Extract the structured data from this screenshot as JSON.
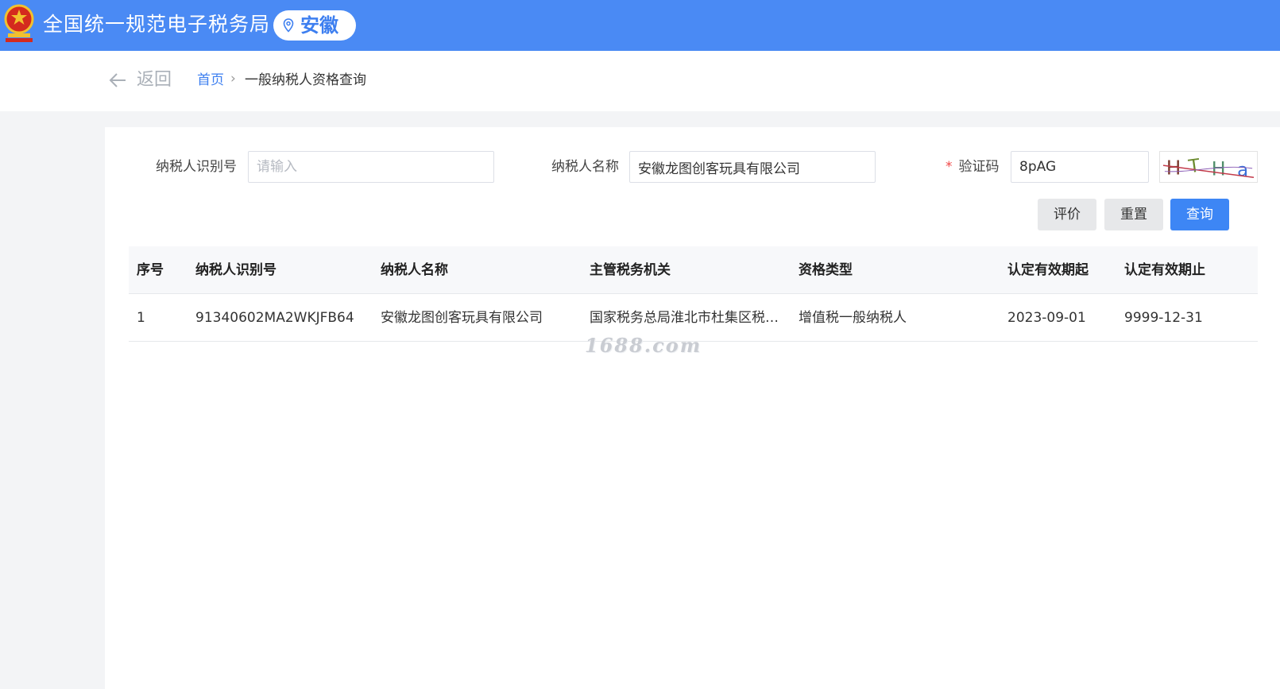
{
  "header": {
    "site_title": "全国统一规范电子税务局",
    "region": "安徽",
    "brand_color": "#4a8af4",
    "emblem_icon": "national-emblem",
    "region_icon": "map-pin-icon"
  },
  "breadcrumb": {
    "back_label": "返回",
    "home": "首页",
    "separator": "›",
    "current": "一般纳税人资格查询"
  },
  "search_form": {
    "taxpayer_id": {
      "label": "纳税人识别号",
      "placeholder": "请输入",
      "value": ""
    },
    "taxpayer_name": {
      "label": "纳税人名称",
      "value": "安徽龙图创客玩具有限公司"
    },
    "captcha": {
      "required_mark": "*",
      "label": "验证码",
      "value": "8pAG",
      "image_text": "HTHa"
    },
    "buttons": {
      "evaluate": "评价",
      "reset": "重置",
      "query": "查询"
    }
  },
  "table": {
    "columns": [
      "序号",
      "纳税人识别号",
      "纳税人名称",
      "主管税务机关",
      "资格类型",
      "认定有效期起",
      "认定有效期止"
    ],
    "rows": [
      [
        "1",
        "91340602MA2WKJFB64",
        "安徽龙图创客玩具有限公司",
        "国家税务总局淮北市杜集区税…",
        "增值税一般纳税人",
        "2023-09-01",
        "9999-12-31"
      ]
    ]
  },
  "watermark": "1688.com"
}
